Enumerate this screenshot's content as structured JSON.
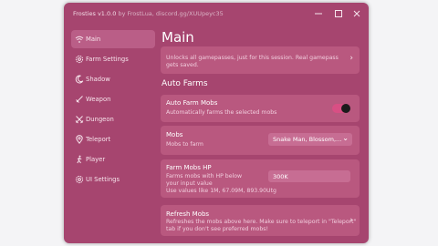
{
  "window": {
    "title": "Frosties v1.0.0",
    "subtitle": "by FrostLua, discord.gg/XUUpeyc35",
    "minimize_icon": "minimize-icon",
    "maximize_icon": "maximize-icon",
    "close_icon": "close-icon"
  },
  "sidebar": {
    "items": [
      {
        "label": "Main",
        "icon": "wifi-icon",
        "active": true
      },
      {
        "label": "Farm Settings",
        "icon": "gear-icon"
      },
      {
        "label": "Shadow",
        "icon": "moon-icon"
      },
      {
        "label": "Weapon",
        "icon": "sword-icon"
      },
      {
        "label": "Dungeon",
        "icon": "crossed-swords-icon"
      },
      {
        "label": "Teleport",
        "icon": "map-pin-icon"
      },
      {
        "label": "Player",
        "icon": "person-icon"
      },
      {
        "label": "UI Settings",
        "icon": "settings-icon"
      }
    ]
  },
  "main": {
    "title": "Main",
    "top_card": {
      "desc": "Unlocks all gamepasses, just for this session. Real gamepass gets saved."
    },
    "section_title": "Auto Farms",
    "auto_farm": {
      "title": "Auto Farm Mobs",
      "desc": "Automatically farms the selected mobs",
      "enabled": true
    },
    "mobs": {
      "title": "Mobs",
      "desc": "Mobs to farm",
      "value": "Snake Man, Blossom,..."
    },
    "farm_hp": {
      "title": "Farm Mobs HP",
      "desc_lines": [
        "Farms mobs with HP below",
        "your input value",
        "Use values like 1M, 67.09M, 893.90Utg"
      ],
      "value": "300K"
    },
    "refresh": {
      "title": "Refresh Mobs",
      "desc_lines": [
        "Refreshes the mobs above here. Make sure to teleport in \"Teleport\"",
        "tab if you don't see preferred mobs!"
      ]
    }
  },
  "colors": {
    "background": "#a6456f",
    "card": "#b9587f",
    "active_nav": "#ba5e87",
    "toggle_on": "#d84f84",
    "input": "#c76d93"
  }
}
